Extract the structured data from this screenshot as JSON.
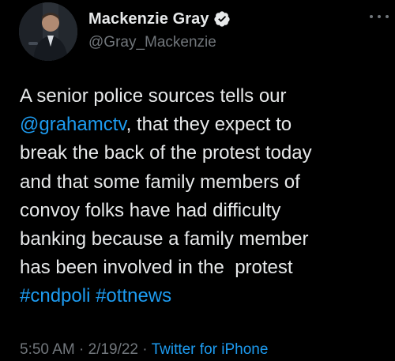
{
  "author": {
    "display_name": "Mackenzie Gray",
    "handle": "@Gray_Mackenzie",
    "verified": true,
    "verified_icon": "verified-badge-icon"
  },
  "tweet": {
    "lines": [
      {
        "text": "A senior police sources tells our"
      },
      {
        "mention": "@grahamctv",
        "text": ", that they expect to"
      },
      {
        "text": "break the back of the protest today"
      },
      {
        "text": "and that some family members of"
      },
      {
        "text": "convoy folks have had difficulty"
      },
      {
        "text": "banking because a family member"
      },
      {
        "text": "has been involved in the  protest"
      },
      {
        "hashtag1": "#cndpoli",
        "space": " ",
        "hashtag2": "#ottnews"
      }
    ]
  },
  "meta": {
    "time": "5:50 AM",
    "separator1": " · ",
    "date": "2/19/22",
    "separator2": " · ",
    "source": "Twitter for iPhone"
  },
  "icons": {
    "more": "more-options-icon"
  },
  "colors": {
    "background": "#000000",
    "text": "#e7e9ea",
    "secondary": "#71767b",
    "accent": "#1d9bf0"
  }
}
